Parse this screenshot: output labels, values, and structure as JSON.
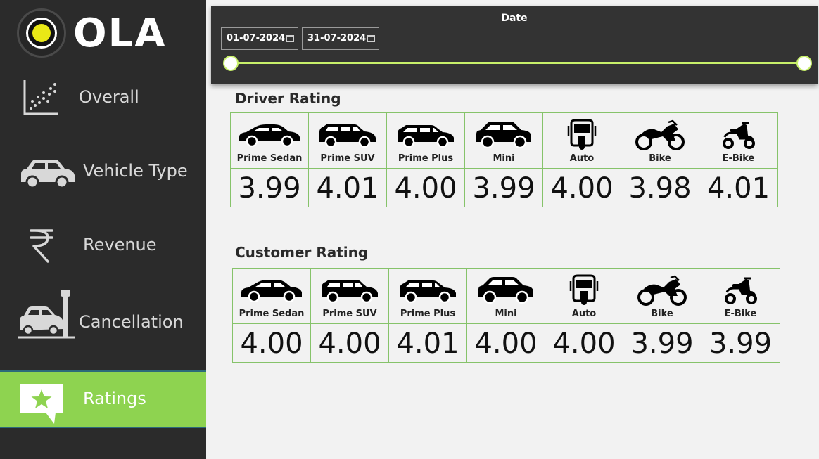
{
  "brand": {
    "name": "OLA"
  },
  "nav": {
    "items": [
      {
        "label": "Overall",
        "icon": "scatter-chart-icon"
      },
      {
        "label": "Vehicle Type",
        "icon": "car-icon"
      },
      {
        "label": "Revenue",
        "icon": "rupee-icon"
      },
      {
        "label": "Cancellation",
        "icon": "car-crash-icon"
      },
      {
        "label": "Ratings",
        "icon": "star-comment-icon",
        "active": true
      }
    ]
  },
  "filter": {
    "title": "Date",
    "start_date": "01-07-2024",
    "end_date": "31-07-2024"
  },
  "driver_rating": {
    "title": "Driver Rating",
    "rows": [
      {
        "label": "Prime Sedan",
        "icon": "sedan-icon",
        "value": "3.99"
      },
      {
        "label": "Prime SUV",
        "icon": "suv-icon",
        "value": "4.01"
      },
      {
        "label": "Prime Plus",
        "icon": "hatchback-icon",
        "value": "4.00"
      },
      {
        "label": "Mini",
        "icon": "mini-car-icon",
        "value": "3.99"
      },
      {
        "label": "Auto",
        "icon": "auto-rickshaw-icon",
        "value": "4.00"
      },
      {
        "label": "Bike",
        "icon": "motorbike-icon",
        "value": "3.98"
      },
      {
        "label": "E-Bike",
        "icon": "scooter-icon",
        "value": "4.01"
      }
    ]
  },
  "customer_rating": {
    "title": "Customer Rating",
    "rows": [
      {
        "label": "Prime Sedan",
        "icon": "sedan-icon",
        "value": "4.00"
      },
      {
        "label": "Prime SUV",
        "icon": "suv-icon",
        "value": "4.00"
      },
      {
        "label": "Prime Plus",
        "icon": "hatchback-icon",
        "value": "4.01"
      },
      {
        "label": "Mini",
        "icon": "mini-car-icon",
        "value": "4.00"
      },
      {
        "label": "Auto",
        "icon": "auto-rickshaw-icon",
        "value": "4.00"
      },
      {
        "label": "Bike",
        "icon": "motorbike-icon",
        "value": "3.99"
      },
      {
        "label": "E-Bike",
        "icon": "scooter-icon",
        "value": "3.99"
      }
    ]
  },
  "colors": {
    "sidebar": "#2b2b2b",
    "active": "#8ed350",
    "accent": "#c8f06a",
    "grid": "#86c36a"
  }
}
